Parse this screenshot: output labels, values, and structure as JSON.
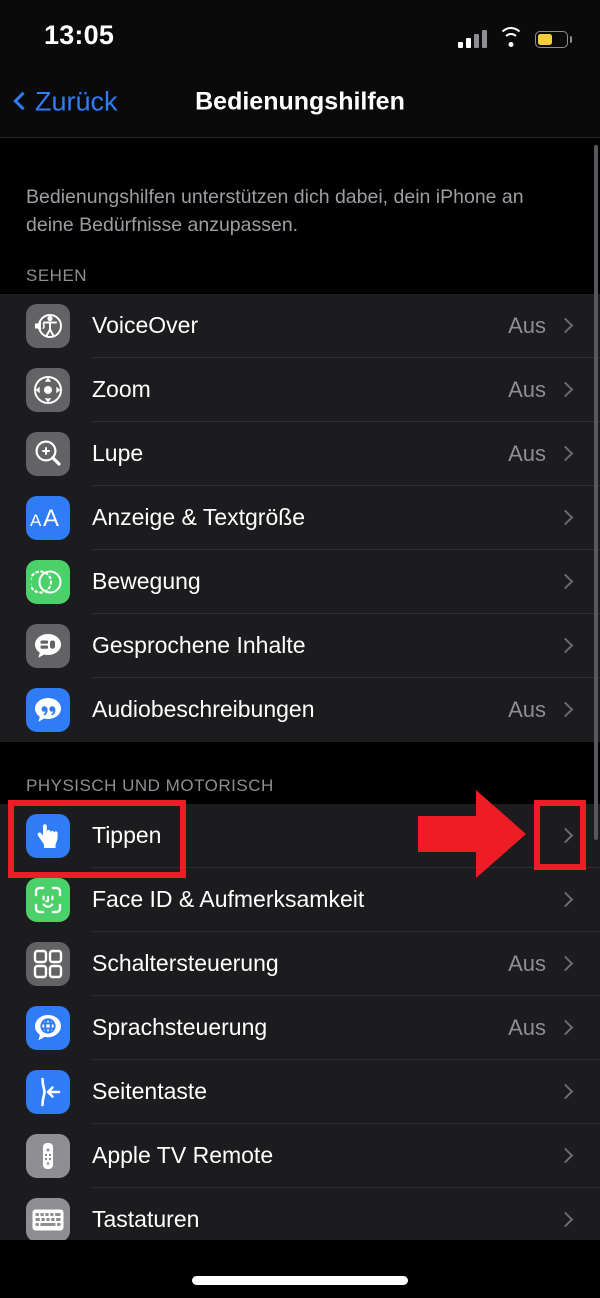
{
  "status_bar": {
    "time": "13:05",
    "cellular_icon": "cellular-signal-icon",
    "cellular_bars_active": 2,
    "wifi_icon": "wifi-icon",
    "battery_icon": "battery-icon",
    "battery_level_percent": 50,
    "battery_color": "#f5cd39"
  },
  "nav": {
    "back_label": "Zurück",
    "back_icon": "chevron-left-icon",
    "title": "Bedienungshilfen",
    "tint_color": "#2f7cf6"
  },
  "intro_text": "Bedienungshilfen unterstützen dich dabei, dein iPhone an deine Bedürfnisse anzupassen.",
  "sections": [
    {
      "header": "SEHEN",
      "rows": [
        {
          "label": "VoiceOver",
          "value": "Aus",
          "icon": "voiceover-icon",
          "icon_bg": "#636366"
        },
        {
          "label": "Zoom",
          "value": "Aus",
          "icon": "zoom-icon",
          "icon_bg": "#636366"
        },
        {
          "label": "Lupe",
          "value": "Aus",
          "icon": "magnifier-icon",
          "icon_bg": "#636366"
        },
        {
          "label": "Anzeige & Textgröße",
          "value": "",
          "icon": "display-text-size-icon",
          "icon_bg": "#2f7cf6"
        },
        {
          "label": "Bewegung",
          "value": "",
          "icon": "motion-icon",
          "icon_bg": "#4cd16a"
        },
        {
          "label": "Gesprochene Inhalte",
          "value": "",
          "icon": "spoken-content-icon",
          "icon_bg": "#636366"
        },
        {
          "label": "Audiobeschreibungen",
          "value": "Aus",
          "icon": "audio-descriptions-icon",
          "icon_bg": "#2f7cf6"
        }
      ]
    },
    {
      "header": "PHYSISCH UND MOTORISCH",
      "rows": [
        {
          "label": "Tippen",
          "value": "",
          "icon": "touch-hand-icon",
          "icon_bg": "#2f7cf6"
        },
        {
          "label": "Face ID & Aufmerksamkeit",
          "value": "",
          "icon": "face-id-icon",
          "icon_bg": "#4cd16a"
        },
        {
          "label": "Schaltersteuerung",
          "value": "Aus",
          "icon": "switch-control-icon",
          "icon_bg": "#636366"
        },
        {
          "label": "Sprachsteuerung",
          "value": "Aus",
          "icon": "voice-control-icon",
          "icon_bg": "#2f7cf6"
        },
        {
          "label": "Seitentaste",
          "value": "",
          "icon": "side-button-icon",
          "icon_bg": "#2f7cf6"
        },
        {
          "label": "Apple TV Remote",
          "value": "",
          "icon": "apple-tv-remote-icon",
          "icon_bg": "#8e8e93"
        },
        {
          "label": "Tastaturen",
          "value": "",
          "icon": "keyboard-icon",
          "icon_bg": "#8e8e93"
        }
      ]
    }
  ],
  "annotations": {
    "color": "#ee1c25",
    "highlight_row_label": "Tippen",
    "highlight_chevron_label": "chevron-right-icon",
    "arrow_icon": "arrow-right-annotation"
  },
  "colors": {
    "page_background": "#000000",
    "row_background": "#1c1c1e",
    "separator": "#2c2c2e",
    "secondary_text": "#8e8e93"
  }
}
